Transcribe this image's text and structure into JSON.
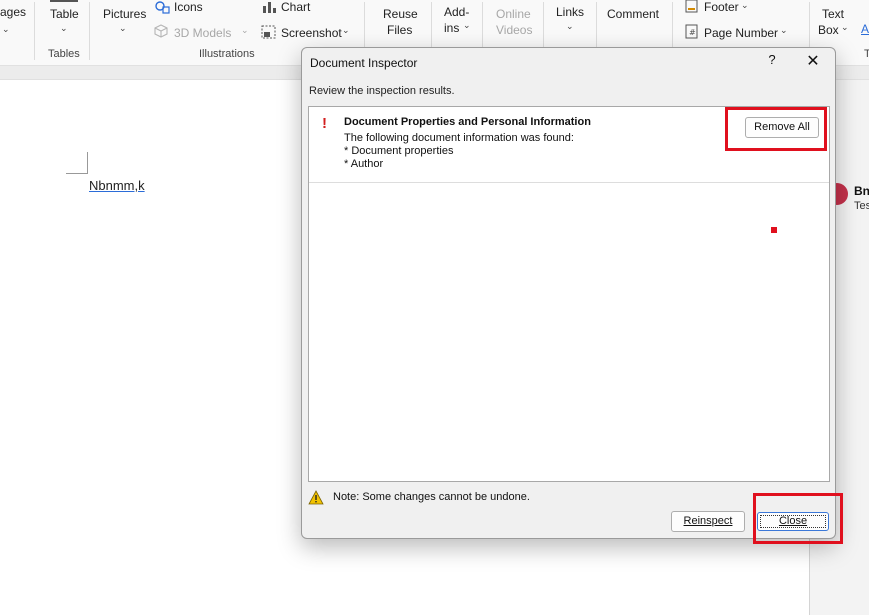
{
  "ribbon": {
    "pages_fragment": "ages",
    "table_label": "Table",
    "tables_group": "Tables",
    "pictures_label": "Pictures",
    "icons_label": "Icons",
    "models_label": "3D Models",
    "chart_label": "Chart",
    "screenshot_label": "Screenshot",
    "illustrations_group": "Illustrations",
    "reuse_line1": "Reuse",
    "reuse_line2": "Files",
    "addins_line1": "Add-",
    "addins_line2": "ins",
    "online_line1": "Online",
    "online_line2": "Videos",
    "links_label": "Links",
    "comment_label": "Comment",
    "footer_label": "Footer",
    "pagenumber_label": "Page Number",
    "textbox_line1": "Text",
    "textbox_line2": "Box",
    "wordart_fragment": "A",
    "tail_fragment": "T"
  },
  "document": {
    "text": "Nbnmm,k",
    "comment_name": "Bn",
    "comment_sub": "Tes"
  },
  "dialog": {
    "title": "Document Inspector",
    "help": "?",
    "close_x": "✕",
    "subtitle": "Review the inspection results.",
    "result": {
      "title": "Document Properties and Personal Information",
      "line1": "The following document information was found:",
      "line2": "* Document properties",
      "line3": "* Author",
      "remove_all": "Remove All"
    },
    "note": "Note: Some changes cannot be undone.",
    "reinspect": "Reinspect",
    "close": "Close",
    "annotation_color": "#e0101e"
  }
}
